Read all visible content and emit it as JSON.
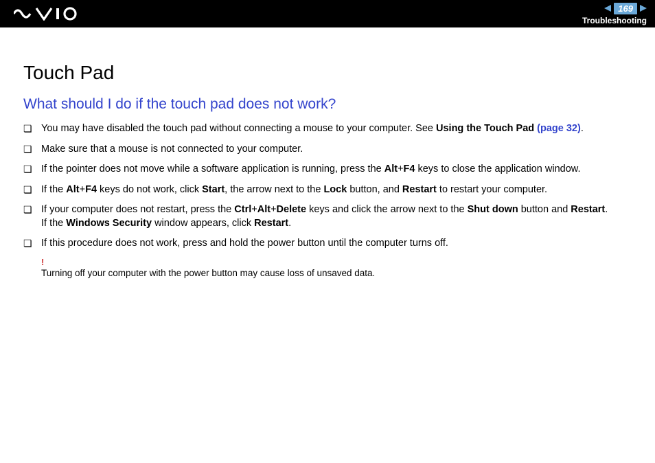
{
  "header": {
    "page_number": "169",
    "section": "Troubleshooting"
  },
  "content": {
    "title": "Touch Pad",
    "subtitle": "What should I do if the touch pad does not work?",
    "items": [
      {
        "pre": "You may have disabled the touch pad without connecting a mouse to your computer. See ",
        "bold1": "Using the Touch Pad ",
        "link": "(page 32)",
        "post": "."
      },
      {
        "text": "Make sure that a mouse is not connected to your computer."
      },
      {
        "pre": "If the pointer does not move while a software application is running, press the ",
        "k1": "Alt",
        "plus1": "+",
        "k2": "F4",
        "post": " keys to close the application window."
      },
      {
        "pre": "If the ",
        "k1": "Alt",
        "plus1": "+",
        "k2": "F4",
        "mid1": " keys do not work, click ",
        "b1": "Start",
        "mid2": ", the arrow next to the ",
        "b2": "Lock",
        "mid3": " button, and ",
        "b3": "Restart",
        "post": " to restart your computer."
      },
      {
        "pre": "If your computer does not restart, press the ",
        "k1": "Ctrl",
        "plus1": "+",
        "k2": "Alt",
        "plus2": "+",
        "k3": "Delete",
        "mid1": " keys and click the arrow next to the ",
        "b1": "Shut down",
        "mid2": " button and ",
        "b2": "Restart",
        "post1": ".",
        "line2a": "If the ",
        "b3": "Windows Security",
        "line2b": " window appears, click ",
        "b4": "Restart",
        "post2": "."
      },
      {
        "text": "If this procedure does not work, press and hold the power button until the computer turns off."
      }
    ],
    "note": {
      "bang": "!",
      "text": "Turning off your computer with the power button may cause loss of unsaved data."
    }
  }
}
